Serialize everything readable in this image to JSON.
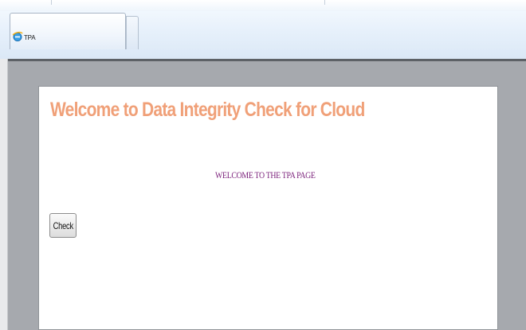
{
  "browser": {
    "tab": {
      "title": "TPA",
      "icon": "ie-browser-icon"
    }
  },
  "page": {
    "heading": "Welcome to Data  Integrity Check for Cloud",
    "welcome_message": "WELCOME TO THE TPA PAGE",
    "check_button_label": "Check"
  },
  "colors": {
    "heading": "#f0a078",
    "welcome_message": "#7a1f7a",
    "page_background": "#a6a9ae",
    "panel_background": "#ffffff"
  }
}
